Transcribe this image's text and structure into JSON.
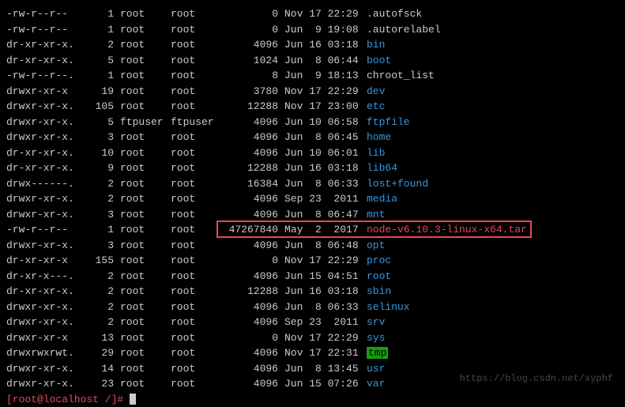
{
  "files": [
    {
      "perms": "-rw-r--r--",
      "links": "1",
      "owner": "root",
      "group": "root",
      "size": "0",
      "date": "Nov 17 22:29",
      "name": ".autofsck",
      "color": "c-white"
    },
    {
      "perms": "-rw-r--r--",
      "links": "1",
      "owner": "root",
      "group": "root",
      "size": "0",
      "date": "Jun  9 19:08",
      "name": ".autorelabel",
      "color": "c-white"
    },
    {
      "perms": "dr-xr-xr-x.",
      "links": "2",
      "owner": "root",
      "group": "root",
      "size": "4096",
      "date": "Jun 16 03:18",
      "name": "bin",
      "color": "c-blue"
    },
    {
      "perms": "dr-xr-xr-x.",
      "links": "5",
      "owner": "root",
      "group": "root",
      "size": "1024",
      "date": "Jun  8 06:44",
      "name": "boot",
      "color": "c-blue"
    },
    {
      "perms": "-rw-r--r--.",
      "links": "1",
      "owner": "root",
      "group": "root",
      "size": "8",
      "date": "Jun  9 18:13",
      "name": "chroot_list",
      "color": "c-white"
    },
    {
      "perms": "drwxr-xr-x",
      "links": "19",
      "owner": "root",
      "group": "root",
      "size": "3780",
      "date": "Nov 17 22:29",
      "name": "dev",
      "color": "c-blue"
    },
    {
      "perms": "drwxr-xr-x.",
      "links": "105",
      "owner": "root",
      "group": "root",
      "size": "12288",
      "date": "Nov 17 23:00",
      "name": "etc",
      "color": "c-blue"
    },
    {
      "perms": "drwxr-xr-x.",
      "links": "5",
      "owner": "ftpuser",
      "group": "ftpuser",
      "size": "4096",
      "date": "Jun 10 06:58",
      "name": "ftpfile",
      "color": "c-blue"
    },
    {
      "perms": "drwxr-xr-x.",
      "links": "3",
      "owner": "root",
      "group": "root",
      "size": "4096",
      "date": "Jun  8 06:45",
      "name": "home",
      "color": "c-blue"
    },
    {
      "perms": "dr-xr-xr-x.",
      "links": "10",
      "owner": "root",
      "group": "root",
      "size": "4096",
      "date": "Jun 10 06:01",
      "name": "lib",
      "color": "c-blue"
    },
    {
      "perms": "dr-xr-xr-x.",
      "links": "9",
      "owner": "root",
      "group": "root",
      "size": "12288",
      "date": "Jun 16 03:18",
      "name": "lib64",
      "color": "c-blue"
    },
    {
      "perms": "drwx------.",
      "links": "2",
      "owner": "root",
      "group": "root",
      "size": "16384",
      "date": "Jun  8 06:33",
      "name": "lost+found",
      "color": "c-blue"
    },
    {
      "perms": "drwxr-xr-x.",
      "links": "2",
      "owner": "root",
      "group": "root",
      "size": "4096",
      "date": "Sep 23  2011",
      "name": "media",
      "color": "c-blue"
    },
    {
      "perms": "drwxr-xr-x.",
      "links": "3",
      "owner": "root",
      "group": "root",
      "size": "4096",
      "date": "Jun  8 06:47",
      "name": "mnt",
      "color": "c-blue"
    },
    {
      "perms": "-rw-r--r--",
      "links": "1",
      "owner": "root",
      "group": "root",
      "size": "47267840",
      "date": "May  2  2017",
      "name": "node-v6.10.3-linux-x64.tar",
      "color": "c-red",
      "highlight": true
    },
    {
      "perms": "drwxr-xr-x.",
      "links": "3",
      "owner": "root",
      "group": "root",
      "size": "4096",
      "date": "Jun  8 06:48",
      "name": "opt",
      "color": "c-blue"
    },
    {
      "perms": "dr-xr-xr-x",
      "links": "155",
      "owner": "root",
      "group": "root",
      "size": "0",
      "date": "Nov 17 22:29",
      "name": "proc",
      "color": "c-blue"
    },
    {
      "perms": "dr-xr-x---.",
      "links": "2",
      "owner": "root",
      "group": "root",
      "size": "4096",
      "date": "Jun 15 04:51",
      "name": "root",
      "color": "c-blue"
    },
    {
      "perms": "dr-xr-xr-x.",
      "links": "2",
      "owner": "root",
      "group": "root",
      "size": "12288",
      "date": "Jun 16 03:18",
      "name": "sbin",
      "color": "c-blue"
    },
    {
      "perms": "drwxr-xr-x.",
      "links": "2",
      "owner": "root",
      "group": "root",
      "size": "4096",
      "date": "Jun  8 06:33",
      "name": "selinux",
      "color": "c-blue"
    },
    {
      "perms": "drwxr-xr-x.",
      "links": "2",
      "owner": "root",
      "group": "root",
      "size": "4096",
      "date": "Sep 23  2011",
      "name": "srv",
      "color": "c-blue"
    },
    {
      "perms": "drwxr-xr-x",
      "links": "13",
      "owner": "root",
      "group": "root",
      "size": "0",
      "date": "Nov 17 22:29",
      "name": "sys",
      "color": "c-blue"
    },
    {
      "perms": "drwxrwxrwt.",
      "links": "29",
      "owner": "root",
      "group": "root",
      "size": "4096",
      "date": "Nov 17 22:31",
      "name": "tmp",
      "color": "bg-green"
    },
    {
      "perms": "drwxr-xr-x.",
      "links": "14",
      "owner": "root",
      "group": "root",
      "size": "4096",
      "date": "Jun  8 13:45",
      "name": "usr",
      "color": "c-blue"
    },
    {
      "perms": "drwxr-xr-x.",
      "links": "23",
      "owner": "root",
      "group": "root",
      "size": "4096",
      "date": "Jun 15 07:26",
      "name": "var",
      "color": "c-blue"
    }
  ],
  "prompt": "[root@localhost /]# ",
  "watermark": "https://blog.csdn.net/xyphf"
}
